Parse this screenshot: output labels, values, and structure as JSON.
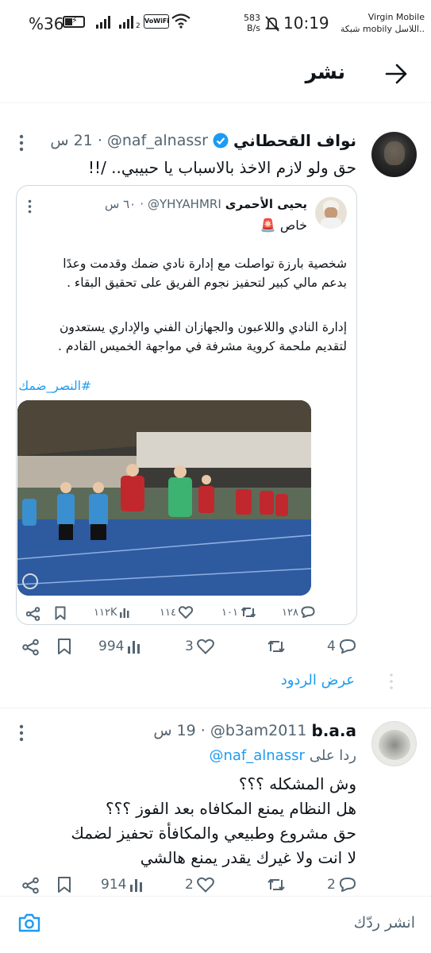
{
  "status_bar": {
    "battery": "%36",
    "time": "10:19",
    "net_speed_value": "583",
    "net_speed_unit": "B/s",
    "vowifi": "VoWiFi",
    "carrier_1": "Virgin Mobile",
    "carrier_2": "شبكة mobily اللاسل..",
    "signal_sim2": "2"
  },
  "header": {
    "title": "نشر"
  },
  "main_tweet": {
    "name": "نواف القحطاني",
    "handle": "@naf_alnassr",
    "time": "21 س",
    "separator": "·",
    "text": "حق ولو لازم الاخذ بالاسباب يا حبيبي.. /!!",
    "quote": {
      "name": "يحيى الأحمرى",
      "handle": "@YHYAHMRI",
      "time": "٦٠ س",
      "separator": "·",
      "label": "خاص 🚨",
      "para1_line1": "شخصية بارزة تواصلت مع إدارة نادي ضمك وقدمت وعدًا",
      "para1_line2": "بدعم مالي كبير لتحفيز نجوم الفريق على تحقيق البقاء .",
      "para2_line1": "إدارة النادي واللاعبون والجهازان الفني والإداري يستعدون",
      "para2_line2": "لتقديم ملحمة كروية مشرفة في مواجهة الخميس القادم .",
      "hashtag": "#النصر_ضمك",
      "actions": {
        "replies": "١٢٨",
        "retweets": "١٠١",
        "likes": "١١٤",
        "views": "١١٢K"
      }
    },
    "actions": {
      "replies": "4",
      "likes": "3",
      "views": "994"
    },
    "show_replies": "عرض الردود"
  },
  "reply_tweet": {
    "name": "b.a.a",
    "handle": "@b3am2011",
    "time": "19 س",
    "separator": "·",
    "replying_prefix": "ردا على",
    "replying_to": "@naf_alnassr",
    "lines": [
      "وش المشكله ؟؟؟",
      "هل النظام يمنع المكافاه بعد الفوز ؟؟؟",
      "حق مشروع وطبيعي والمكافأة تحفيز لضمك",
      "لا انت ولا غيرك يقدر يمنع هالشي"
    ],
    "actions": {
      "replies": "2",
      "likes": "2",
      "views": "914"
    }
  },
  "composer": {
    "placeholder": "انشر ردّك"
  },
  "colors": {
    "accent": "#1d9bf0",
    "text": "#0f1419",
    "secondary": "#536471",
    "border": "#cfd9de"
  }
}
